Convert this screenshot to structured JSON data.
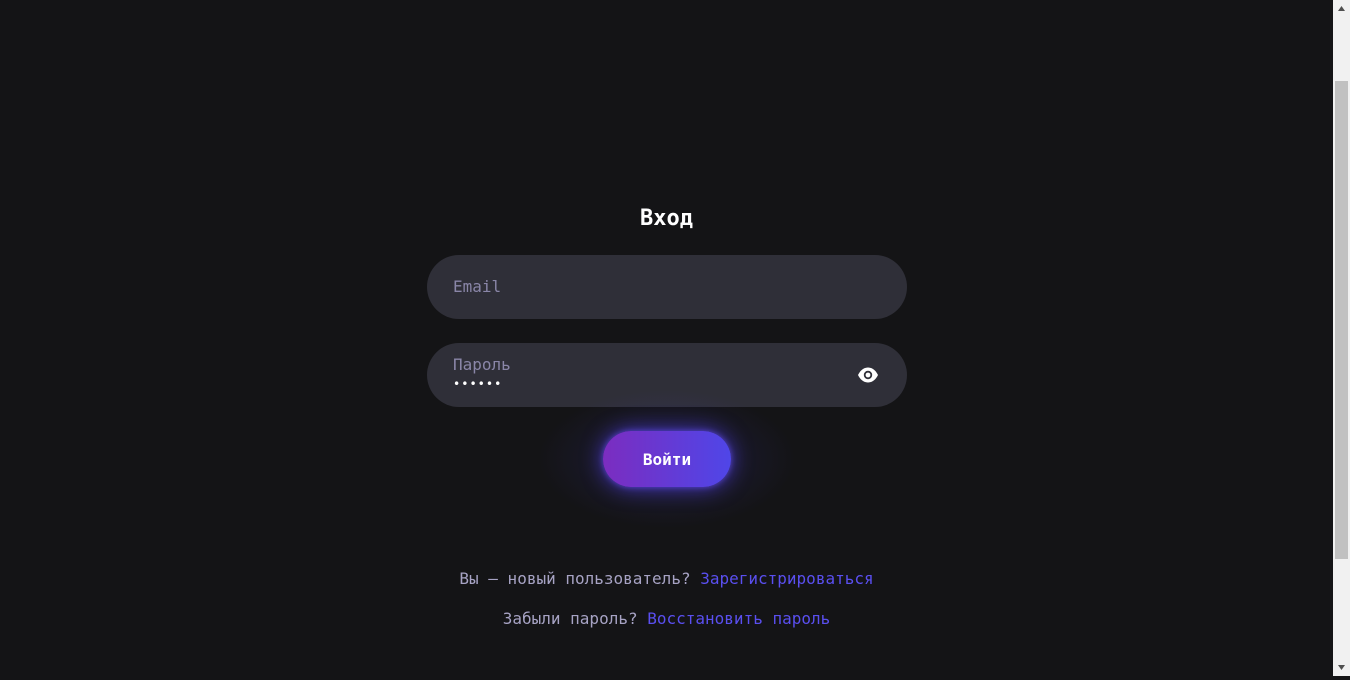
{
  "form": {
    "title": "Вход",
    "email_placeholder": "Email",
    "password_label": "Пароль",
    "password_value": "••••••",
    "submit_label": "Войти"
  },
  "links": {
    "register_prompt": "Вы — новый пользователь?",
    "register_link": "Зарегистрироваться",
    "forgot_prompt": "Забыли пароль?",
    "forgot_link": "Восстановить пароль"
  },
  "icons": {
    "password_toggle": "eye-icon",
    "scroll_up": "triangle-up-icon",
    "scroll_down": "triangle-down-icon"
  },
  "colors": {
    "background": "#141416",
    "field_background": "#2f2f38",
    "placeholder": "#8a86a8",
    "accent_link": "#5a4ff0",
    "button_gradient_start": "#7b2dc0",
    "button_gradient_end": "#4f46e8"
  }
}
